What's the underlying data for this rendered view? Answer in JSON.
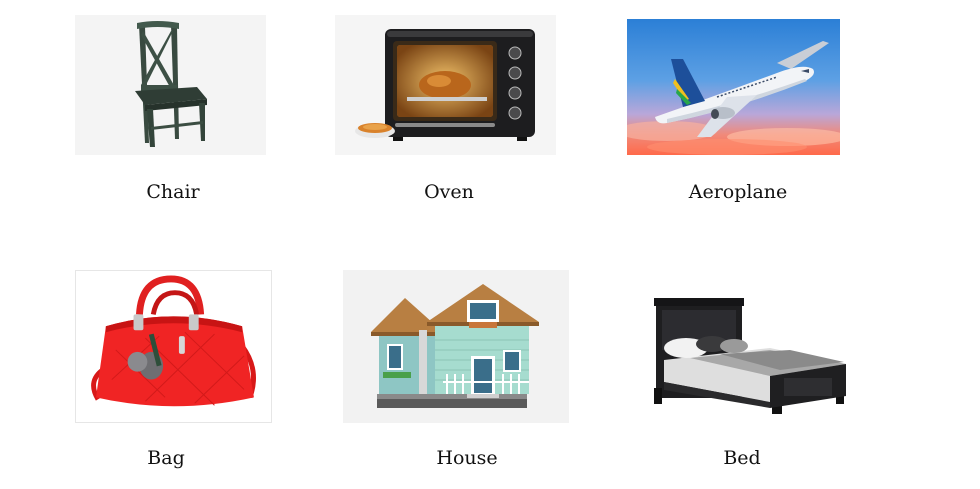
{
  "items": [
    {
      "label": "Chair",
      "icon": "chair-icon"
    },
    {
      "label": "Oven",
      "icon": "oven-icon"
    },
    {
      "label": "Aeroplane",
      "icon": "aeroplane-icon"
    },
    {
      "label": "Bag",
      "icon": "bag-icon"
    },
    {
      "label": "House",
      "icon": "house-icon"
    },
    {
      "label": "Bed",
      "icon": "bed-icon"
    }
  ]
}
